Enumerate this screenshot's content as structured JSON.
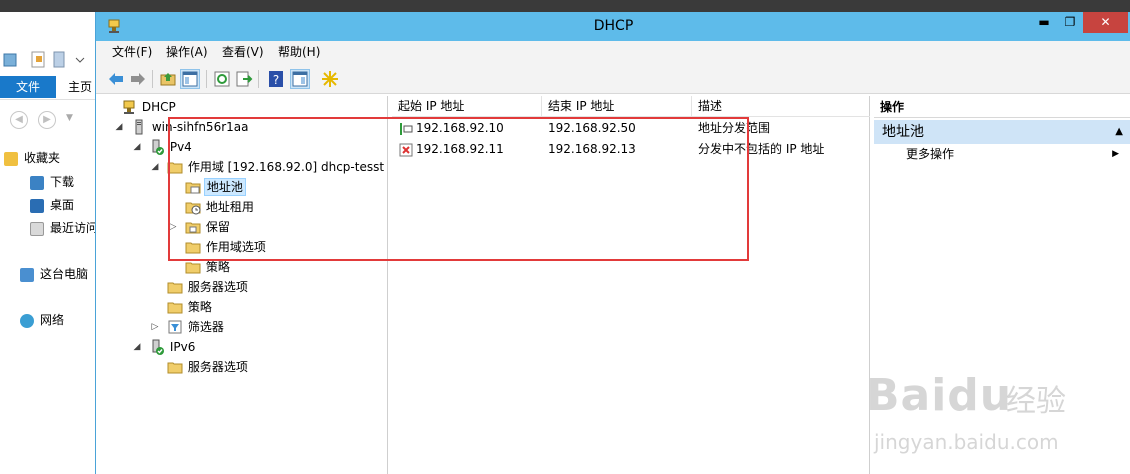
{
  "window": {
    "title": "DHCP",
    "min_glyph": "▬",
    "max_glyph": "❐",
    "close_glyph": "✕"
  },
  "menu": [
    "文件(F)",
    "操作(A)",
    "查看(V)",
    "帮助(H)"
  ],
  "tree": [
    {
      "label": "DHCP",
      "icon": "dhcp-icon"
    },
    {
      "label": "win-sihfn56r1aa",
      "icon": "server-icon",
      "expanded": true
    },
    {
      "label": "Pv4",
      "icon": "ipv4-icon",
      "expanded": true
    },
    {
      "label": "作用域 [192.168.92.0] dhcp-tesst",
      "icon": "folder-icon",
      "expanded": true
    },
    {
      "label": "地址池",
      "icon": "address-pool-icon",
      "selected": true
    },
    {
      "label": "地址租用",
      "icon": "lease-icon"
    },
    {
      "label": "保留",
      "icon": "reservation-icon",
      "expanded": false
    },
    {
      "label": "作用域选项",
      "icon": "folder-icon"
    },
    {
      "label": "策略",
      "icon": "folder-icon"
    },
    {
      "label": "服务器选项",
      "icon": "folder-icon"
    },
    {
      "label": "策略",
      "icon": "folder-icon"
    },
    {
      "label": "筛选器",
      "icon": "filter-icon",
      "expanded": false
    },
    {
      "label": "IPv6",
      "icon": "ipv6-icon",
      "expanded": true
    },
    {
      "label": "服务器选项",
      "icon": "folder-icon"
    }
  ],
  "list": {
    "columns": [
      "起始 IP 地址",
      "结束 IP 地址",
      "描述"
    ],
    "rows": [
      {
        "start": "192.168.92.10",
        "end": "192.168.92.50",
        "desc": "地址分发范围",
        "icon": "range-icon"
      },
      {
        "start": "192.168.92.11",
        "end": "192.168.92.13",
        "desc": "分发中不包括的 IP 地址",
        "icon": "exclusion-icon"
      }
    ]
  },
  "actions": {
    "header": "操作",
    "group": "地址池",
    "more": "更多操作"
  },
  "bg": {
    "file_tab": "文件",
    "home_tab": "主页",
    "favorites": "收藏夹",
    "downloads": "下载",
    "desktop": "桌面",
    "recent": "最近访问",
    "this_pc": "这台电脑",
    "network": "网络"
  },
  "watermark": {
    "logo": "Baidu",
    "text": "经验",
    "url": "jingyan.baidu.com"
  },
  "colors": {
    "titlebar": "#5ebbea",
    "close": "#c7443f",
    "highlight": "#e23a3a",
    "selection": "#cce8ff",
    "actions_group": "#cfe4f7"
  }
}
